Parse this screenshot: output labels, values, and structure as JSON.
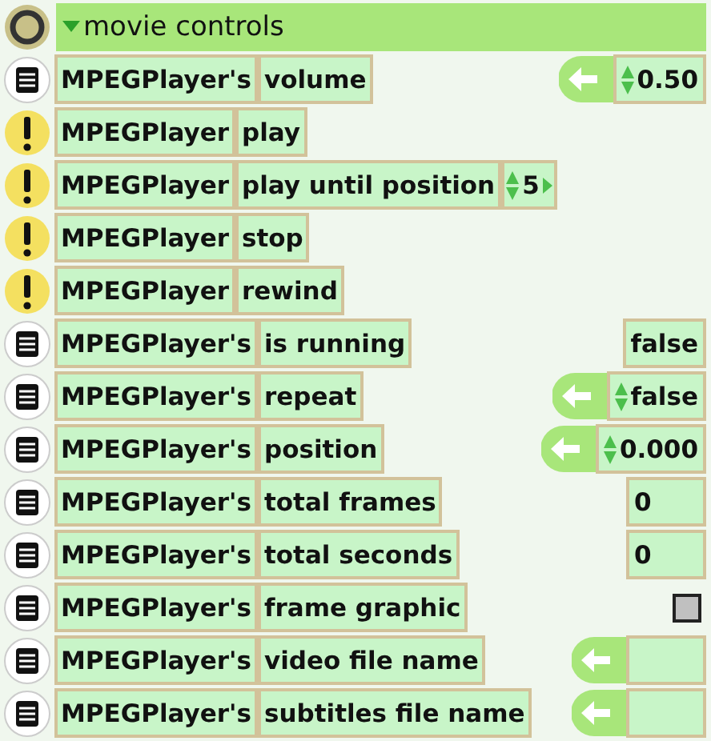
{
  "header": {
    "title": "movie controls",
    "expanded": true
  },
  "rows": [
    {
      "kind": "property",
      "object": "MPEGPlayer's",
      "name": "volume",
      "settable": true,
      "value": {
        "kind": "text",
        "text": "0.50",
        "editable": true
      }
    },
    {
      "kind": "command",
      "object": "MPEGPlayer",
      "name": "play"
    },
    {
      "kind": "command",
      "object": "MPEGPlayer",
      "name": "play until position",
      "arg": "5"
    },
    {
      "kind": "command",
      "object": "MPEGPlayer",
      "name": "stop"
    },
    {
      "kind": "command",
      "object": "MPEGPlayer",
      "name": "rewind"
    },
    {
      "kind": "property",
      "object": "MPEGPlayer's",
      "name": "is running",
      "settable": false,
      "value": {
        "kind": "text",
        "text": "false",
        "editable": false
      }
    },
    {
      "kind": "property",
      "object": "MPEGPlayer's",
      "name": "repeat",
      "settable": true,
      "value": {
        "kind": "text",
        "text": "false",
        "editable": true
      }
    },
    {
      "kind": "property",
      "object": "MPEGPlayer's",
      "name": "position",
      "settable": true,
      "value": {
        "kind": "text",
        "text": "0.000",
        "editable": true
      }
    },
    {
      "kind": "property",
      "object": "MPEGPlayer's",
      "name": "total frames",
      "settable": false,
      "value": {
        "kind": "text",
        "text": "0",
        "editable": false
      }
    },
    {
      "kind": "property",
      "object": "MPEGPlayer's",
      "name": "total seconds",
      "settable": false,
      "value": {
        "kind": "text",
        "text": "0",
        "editable": false
      }
    },
    {
      "kind": "property",
      "object": "MPEGPlayer's",
      "name": "frame graphic",
      "settable": false,
      "value": {
        "kind": "graphic"
      }
    },
    {
      "kind": "property",
      "object": "MPEGPlayer's",
      "name": "video file name",
      "settable": true,
      "value": {
        "kind": "text",
        "editable": false
      }
    },
    {
      "kind": "property",
      "object": "MPEGPlayer's",
      "name": "subtitles file name",
      "settable": true,
      "value": {
        "kind": "text",
        "editable": false
      }
    }
  ]
}
